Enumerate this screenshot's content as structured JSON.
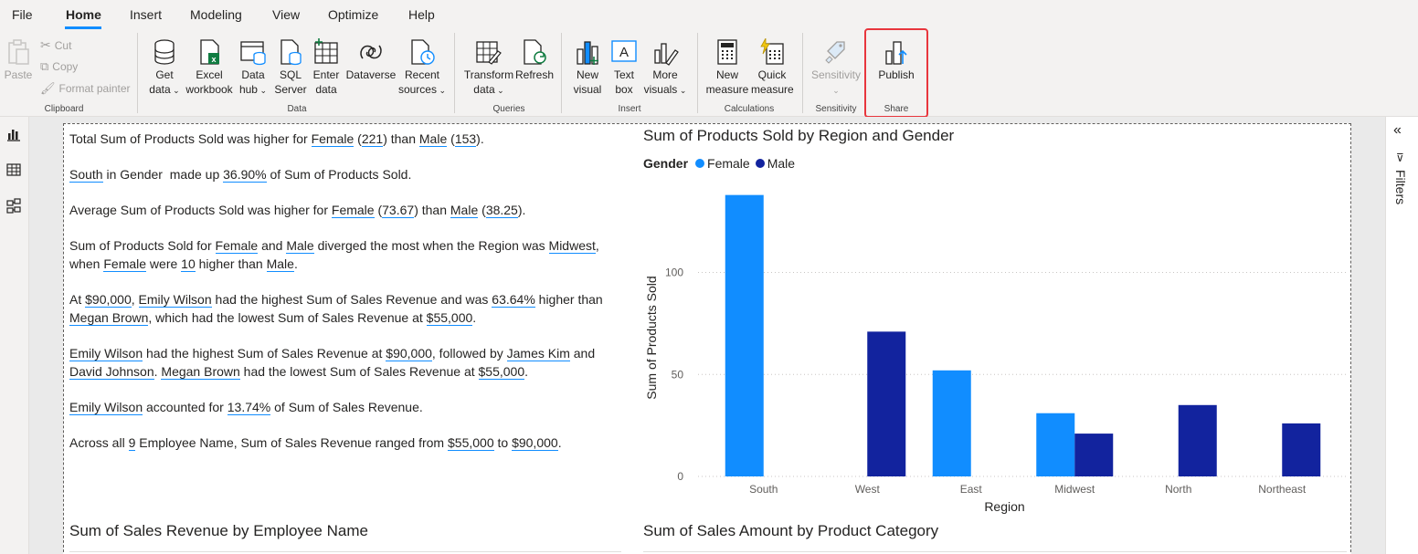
{
  "menu": {
    "items": [
      "File",
      "Home",
      "Insert",
      "Modeling",
      "View",
      "Optimize",
      "Help"
    ],
    "active": "Home"
  },
  "ribbon": {
    "clipboard": {
      "paste": "Paste",
      "cut": "Cut",
      "copy": "Copy",
      "format_painter": "Format painter",
      "label": "Clipboard"
    },
    "data": {
      "get_data": [
        "Get",
        "data"
      ],
      "excel": [
        "Excel",
        "workbook"
      ],
      "data_hub": [
        "Data",
        "hub"
      ],
      "sql": [
        "SQL",
        "Server"
      ],
      "enter": [
        "Enter",
        "data"
      ],
      "dataverse": "Dataverse",
      "recent": [
        "Recent",
        "sources"
      ],
      "label": "Data"
    },
    "queries": {
      "transform": [
        "Transform",
        "data"
      ],
      "refresh": "Refresh",
      "label": "Queries"
    },
    "insert": {
      "new_visual": [
        "New",
        "visual"
      ],
      "text_box": [
        "Text",
        "box"
      ],
      "more_visuals": [
        "More",
        "visuals"
      ],
      "label": "Insert"
    },
    "calculations": {
      "new_measure": [
        "New",
        "measure"
      ],
      "quick_measure": [
        "Quick",
        "measure"
      ],
      "label": "Calculations"
    },
    "sensitivity": {
      "button": "Sensitivity",
      "label": "Sensitivity"
    },
    "share": {
      "publish": "Publish",
      "label": "Share"
    }
  },
  "rightpane": {
    "filters": "Filters"
  },
  "narrative": {
    "p1": {
      "a": "Total Sum of Products Sold was higher for ",
      "b": "Female",
      "c": " (",
      "d": "221",
      "e": ") than ",
      "f": "Male",
      "g": " (",
      "h": "153",
      "i": ")."
    },
    "p2": {
      "a": "South",
      "b": " in Gender  made up ",
      "c": "36.90%",
      "d": " of Sum of Products Sold."
    },
    "p3": {
      "a": "Average Sum of Products Sold was higher for ",
      "b": "Female",
      "c": " (",
      "d": "73.67",
      "e": ") than ",
      "f": "Male",
      "g": " (",
      "h": "38.25",
      "i": ")."
    },
    "p4": {
      "a": "Sum of Products Sold for ",
      "b": "Female",
      "c": " and ",
      "d": "Male",
      "e": " diverged the most when the Region was ",
      "f": "Midwest",
      "g": ", when ",
      "h": "Female",
      "i": " were ",
      "j": "10",
      "k": " higher than ",
      "l": "Male",
      "m": "."
    },
    "p5": {
      "a": "At ",
      "b": "$90,000",
      "c": ", ",
      "d": "Emily Wilson",
      "e": " had the highest Sum of Sales Revenue and was ",
      "f": "63.64%",
      "g": " higher than ",
      "h": "Megan Brown",
      "i": ", which had the lowest Sum of Sales Revenue at ",
      "j": "$55,000",
      "k": "."
    },
    "p6": {
      "a": "Emily Wilson",
      "b": " had the highest Sum of Sales Revenue at ",
      "c": "$90,000",
      "d": ", followed by ",
      "e": "James Kim",
      "f": " and ",
      "g": "David Johnson",
      "h": ". ",
      "i": "Megan Brown",
      "j": " had the lowest Sum of Sales Revenue at ",
      "k": "$55,000",
      "l": "."
    },
    "p7": {
      "a": "Emily Wilson",
      "b": " accounted for ",
      "c": "13.74%",
      "d": " of Sum of Sales Revenue."
    },
    "p8": {
      "a": "Across all ",
      "b": "9",
      "c": " Employee Name, Sum of Sales Revenue ranged from ",
      "d": "$55,000",
      "e": " to ",
      "f": "$90,000",
      "g": "."
    }
  },
  "visuals": {
    "bottom_left_title": "Sum of Sales Revenue by Employee Name",
    "bottom_right_title": "Sum of Sales Amount by Product Category"
  },
  "chart_data": {
    "type": "bar",
    "title": "Sum of Products Sold by Region and Gender",
    "legend_title": "Gender",
    "xlabel": "Region",
    "ylabel": "Sum of Products Sold",
    "categories": [
      "South",
      "West",
      "East",
      "Midwest",
      "North",
      "Northeast"
    ],
    "series": [
      {
        "name": "Female",
        "color": "#118dff",
        "values": [
          138,
          0,
          52,
          31,
          0,
          0
        ]
      },
      {
        "name": "Male",
        "color": "#12239e",
        "values": [
          0,
          71,
          0,
          21,
          35,
          26
        ]
      }
    ],
    "yticks": [
      0,
      50,
      100
    ],
    "ylim": [
      0,
      145
    ],
    "grid": true,
    "legend_position": "top-left"
  }
}
